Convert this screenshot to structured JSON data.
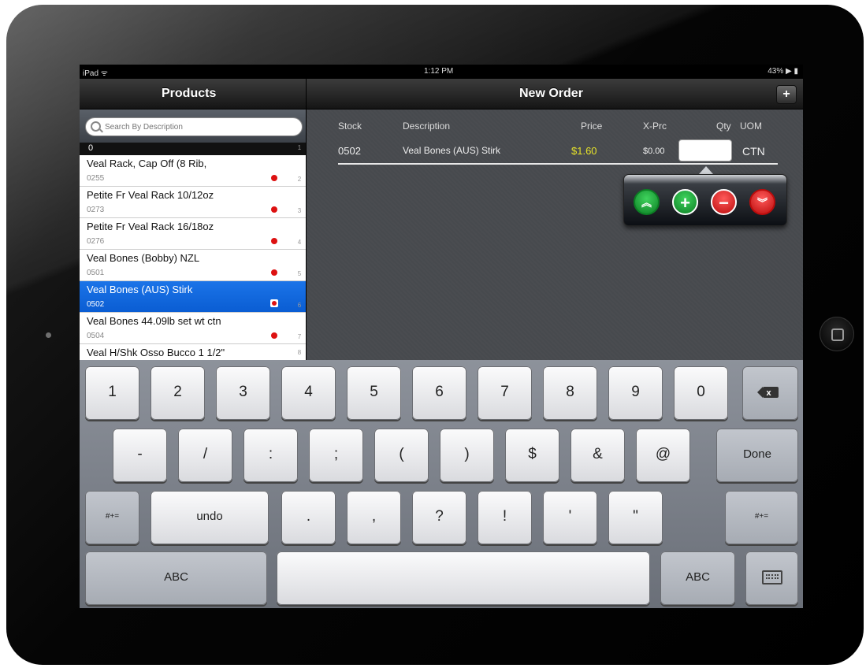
{
  "status_bar": {
    "carrier": "iPad ᯤ",
    "time": "1:12 PM",
    "battery": "43% ▶ ▮"
  },
  "products_panel": {
    "title": "Products",
    "search_placeholder": "Search By Description",
    "section_header": "0",
    "items": [
      {
        "name": "Veal Rack, Cap Off (8 Rib,",
        "code": "0255"
      },
      {
        "name": "Petite Fr Veal Rack 10/12oz",
        "code": "0273"
      },
      {
        "name": "Petite Fr Veal Rack 16/18oz",
        "code": "0276"
      },
      {
        "name": "Veal Bones (Bobby) NZL",
        "code": "0501"
      },
      {
        "name": "Veal Bones (AUS) Stirk",
        "code": "0502",
        "selected": true
      },
      {
        "name": "Veal Bones 44.09lb set wt ctn",
        "code": "0504"
      },
      {
        "name": "Veal H/Shk Osso Bucco 1 1/2\"",
        "code": ""
      }
    ],
    "index_letters": [
      "0",
      "1",
      "2",
      "3",
      "4",
      "5",
      "6",
      "7",
      "8"
    ]
  },
  "order_panel": {
    "title": "New Order",
    "add_button": "+",
    "columns": {
      "stock": "Stock",
      "description": "Description",
      "price": "Price",
      "x_price": "X-Prc",
      "qty": "Qty",
      "uom": "UOM"
    },
    "lines": [
      {
        "stock": "0502",
        "description": "Veal Bones (AUS) Stirk",
        "price": "$1.60",
        "x_price": "$0.00",
        "qty": "",
        "uom": "CTN"
      }
    ],
    "qty_popover": {
      "buttons": [
        "max-up",
        "plus",
        "minus",
        "max-down"
      ]
    }
  },
  "keyboard": {
    "row1": [
      "1",
      "2",
      "3",
      "4",
      "5",
      "6",
      "7",
      "8",
      "9",
      "0"
    ],
    "row2": [
      "-",
      "/",
      ":",
      ";",
      "(",
      ")",
      "$",
      "&",
      "@"
    ],
    "done": "Done",
    "row3_left": "#+=",
    "undo": "undo",
    "row3": [
      ".",
      ",",
      "?",
      "!",
      "'",
      "\""
    ],
    "row3_right": "#+=",
    "abc_left": "ABC",
    "abc_right": "ABC",
    "price_color": "#e6e22a"
  }
}
